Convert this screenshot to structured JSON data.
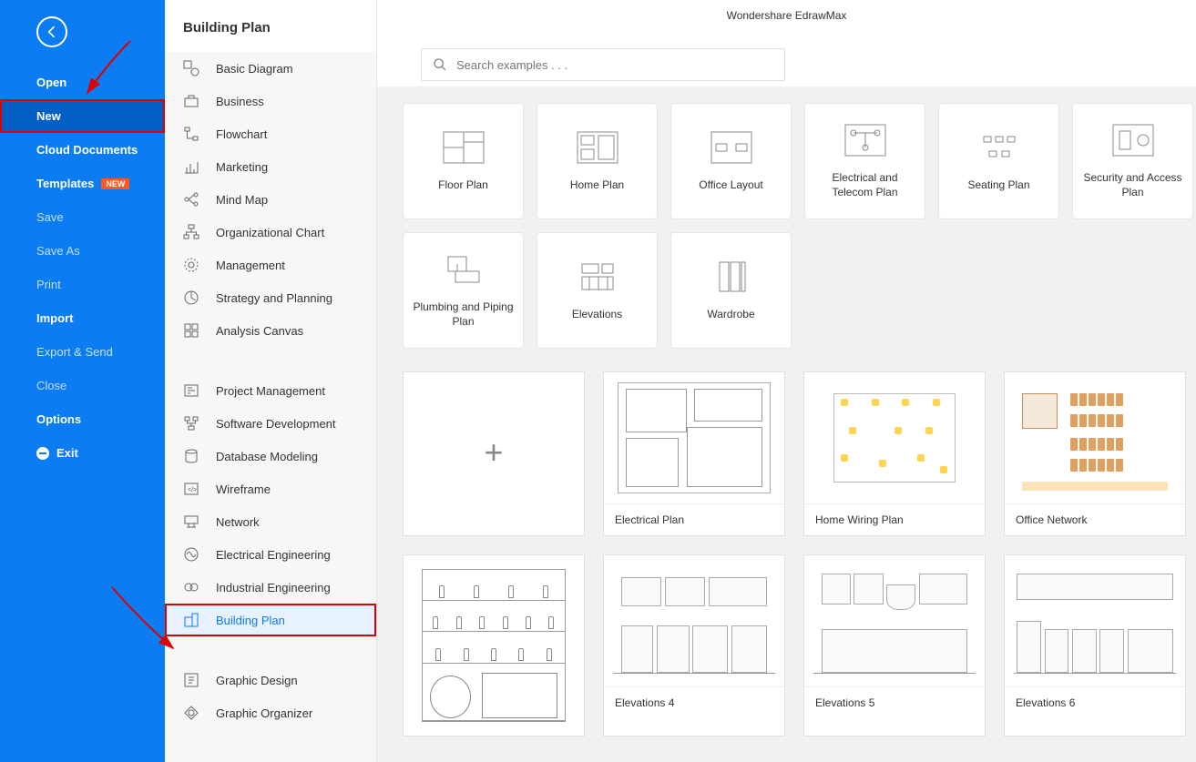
{
  "appTitle": "Wondershare EdrawMax",
  "leftSidebar": {
    "open": "Open",
    "new": "New",
    "cloudDocuments": "Cloud Documents",
    "templates": "Templates",
    "templatesBadge": "NEW",
    "save": "Save",
    "saveAs": "Save As",
    "print": "Print",
    "import": "Import",
    "exportSend": "Export & Send",
    "close": "Close",
    "options": "Options",
    "exit": "Exit"
  },
  "categoryHeader": "Building Plan",
  "categories": {
    "basicDiagram": "Basic Diagram",
    "business": "Business",
    "flowchart": "Flowchart",
    "marketing": "Marketing",
    "mindMap": "Mind Map",
    "orgChart": "Organizational Chart",
    "management": "Management",
    "strategy": "Strategy and Planning",
    "analysis": "Analysis Canvas",
    "projectMgmt": "Project Management",
    "softwareDev": "Software Development",
    "dbModel": "Database Modeling",
    "wireframe": "Wireframe",
    "network": "Network",
    "elecEng": "Electrical Engineering",
    "indEng": "Industrial Engineering",
    "buildingPlan": "Building Plan",
    "graphicDesign": "Graphic Design",
    "graphicOrg": "Graphic Organizer"
  },
  "search": {
    "placeholder": "Search examples . . ."
  },
  "templateTypes": {
    "floorPlan": "Floor Plan",
    "homePlan": "Home Plan",
    "officeLayout": "Office Layout",
    "elecTelecom": "Electrical and Telecom Plan",
    "seatingPlan": "Seating Plan",
    "securityAccess": "Security and Access Plan",
    "plumbing": "Plumbing and Piping Plan",
    "elevations": "Elevations",
    "wardrobe": "Wardrobe"
  },
  "examples": {
    "electricalPlan": "Electrical Plan",
    "homeWiring": "Home Wiring Plan",
    "officeNetwork": "Office Network",
    "elevations4": "Elevations 4",
    "elevations5": "Elevations 5",
    "elevations6": "Elevations 6"
  }
}
